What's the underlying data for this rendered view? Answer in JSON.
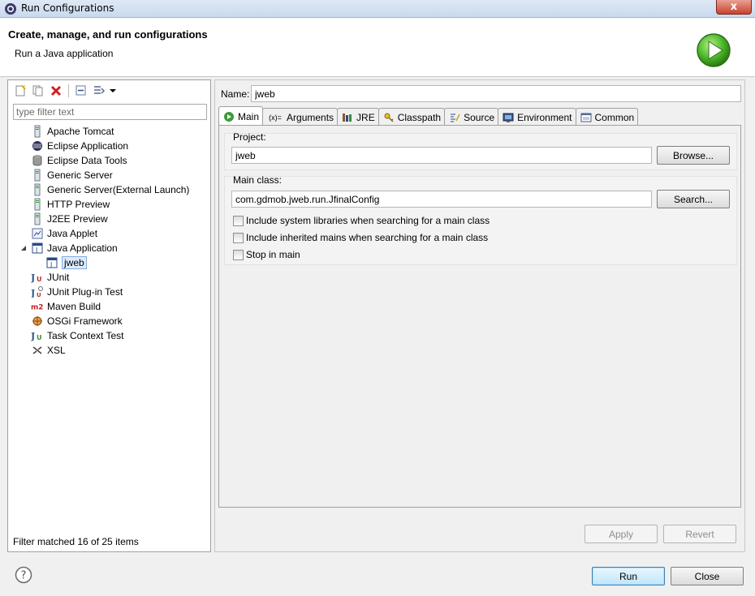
{
  "window": {
    "title": "Run Configurations",
    "close_label": "x"
  },
  "header": {
    "title": "Create, manage, and run configurations",
    "subtitle": "Run a Java application"
  },
  "left": {
    "filter_placeholder": "type filter text",
    "tree": [
      {
        "label": "Apache Tomcat",
        "icon": "tomcat-icon",
        "level": 1
      },
      {
        "label": "Eclipse Application",
        "icon": "eclipse-icon",
        "level": 1
      },
      {
        "label": "Eclipse Data Tools",
        "icon": "database-icon",
        "level": 1
      },
      {
        "label": "Generic Server",
        "icon": "server-icon",
        "level": 1
      },
      {
        "label": "Generic Server(External Launch)",
        "icon": "server-icon",
        "level": 1
      },
      {
        "label": "HTTP Preview",
        "icon": "server-icon",
        "level": 1
      },
      {
        "label": "J2EE Preview",
        "icon": "server-icon",
        "level": 1
      },
      {
        "label": "Java Applet",
        "icon": "applet-icon",
        "level": 1
      },
      {
        "label": "Java Application",
        "icon": "java-app-icon",
        "level": 1,
        "expanded": true
      },
      {
        "label": "jweb",
        "icon": "java-app-icon",
        "level": 2,
        "selected": true
      },
      {
        "label": "JUnit",
        "icon": "junit-icon",
        "level": 1
      },
      {
        "label": "JUnit Plug-in Test",
        "icon": "junit-plugin-icon",
        "level": 1
      },
      {
        "label": "Maven Build",
        "icon": "maven-icon",
        "level": 1
      },
      {
        "label": "OSGi Framework",
        "icon": "osgi-icon",
        "level": 1
      },
      {
        "label": "Task Context Test",
        "icon": "task-context-icon",
        "level": 1
      },
      {
        "label": "XSL",
        "icon": "xsl-icon",
        "level": 1
      }
    ],
    "filter_status": "Filter matched 16 of 25 items"
  },
  "right": {
    "name_label": "Name:",
    "name_value": "jweb",
    "tabs": [
      {
        "label": "Main",
        "icon": "main-tab-icon",
        "active": true
      },
      {
        "label": "Arguments",
        "icon": "arguments-icon"
      },
      {
        "label": "JRE",
        "icon": "jre-icon"
      },
      {
        "label": "Classpath",
        "icon": "classpath-icon"
      },
      {
        "label": "Source",
        "icon": "source-icon"
      },
      {
        "label": "Environment",
        "icon": "environment-icon"
      },
      {
        "label": "Common",
        "icon": "common-icon"
      }
    ],
    "arguments_prefix": "(x)=",
    "project_label": "Project:",
    "project_value": "jweb",
    "browse_label": "Browse...",
    "main_class_label": "Main class:",
    "main_class_value": "com.gdmob.jweb.run.JfinalConfig",
    "search_label": "Search...",
    "checkboxes": [
      {
        "label": "Include system libraries when searching for a main class",
        "checked": false
      },
      {
        "label": "Include inherited mains when searching for a main class",
        "checked": false
      },
      {
        "label": "Stop in main",
        "checked": false
      }
    ],
    "apply_label": "Apply",
    "revert_label": "Revert"
  },
  "footer": {
    "run_label": "Run",
    "close_label": "Close",
    "help_label": "?"
  }
}
